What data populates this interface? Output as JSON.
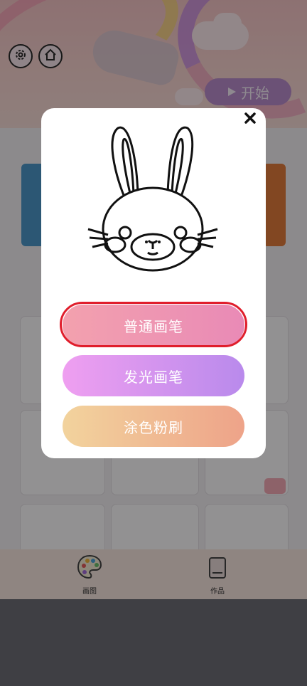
{
  "banner": {
    "start_label": "开始"
  },
  "tabbar": {
    "tab_draw": "画图",
    "tab_works": "作品"
  },
  "dialog": {
    "close_symbol": "✕",
    "options": [
      "普通画笔",
      "发光画笔",
      "涂色粉刷"
    ],
    "selected_index": 0
  },
  "colors": {
    "option1": "#ee95b1",
    "option2": "#d497ee",
    "option3": "#f0bb93",
    "highlight": "#e01e2c"
  },
  "icons": [
    "gear-icon",
    "home-icon",
    "play-icon",
    "close-icon",
    "palette-icon",
    "book-icon",
    "camera-icon"
  ]
}
